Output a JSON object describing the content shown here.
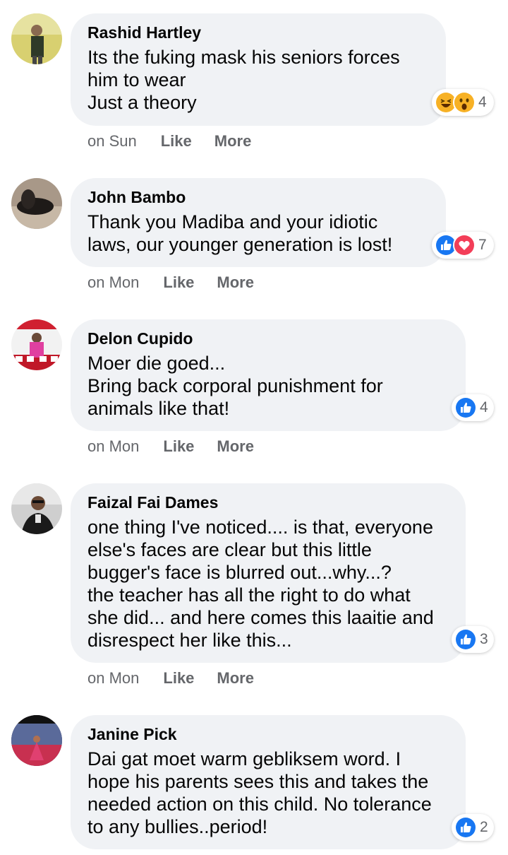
{
  "comments": [
    {
      "author": "Rashid Hartley",
      "text": "Its the fuking mask his seniors forces\nhim to wear\nJust a theory",
      "reaction_icons": [
        "laugh-icon",
        "wow-icon"
      ],
      "reaction_count": "4",
      "time": "on Sun",
      "like_label": "Like",
      "more_label": "More"
    },
    {
      "author": "John Bambo",
      "text": "Thank you Madiba and your idiotic\nlaws, our younger generation is lost!",
      "reaction_icons": [
        "like-icon",
        "love-icon"
      ],
      "reaction_count": "7",
      "time": "on Mon",
      "like_label": "Like",
      "more_label": "More"
    },
    {
      "author": "Delon Cupido",
      "text": "Moer die goed...\nBring back corporal punishment for\nanimals like that!",
      "reaction_icons": [
        "like-icon"
      ],
      "reaction_count": "4",
      "time": "on Mon",
      "like_label": "Like",
      "more_label": "More"
    },
    {
      "author": "Faizal Fai Dames",
      "text": "one thing I've noticed.... is that, everyone\nelse's faces are clear but this little\nbugger's face is blurred out...why...?\nthe teacher has all the right to do what\nshe did... and here comes this laaitie and\ndisrespect her like this...",
      "reaction_icons": [
        "like-icon"
      ],
      "reaction_count": "3",
      "time": "on Mon",
      "like_label": "Like",
      "more_label": "More"
    },
    {
      "author": "Janine Pick",
      "text": "Dai gat moet warm gebliksem word. I\nhope his parents sees this and takes the\nneeded action on this child. No tolerance\nto any bullies..period!",
      "reaction_icons": [
        "like-icon"
      ],
      "reaction_count": "2"
    }
  ],
  "colors": {
    "bubble": "#f0f2f5",
    "like_blue": "#1877f2",
    "love_red": "#f33e58",
    "haha_yellow": "#f7b125",
    "meta_gray": "#65676b"
  }
}
